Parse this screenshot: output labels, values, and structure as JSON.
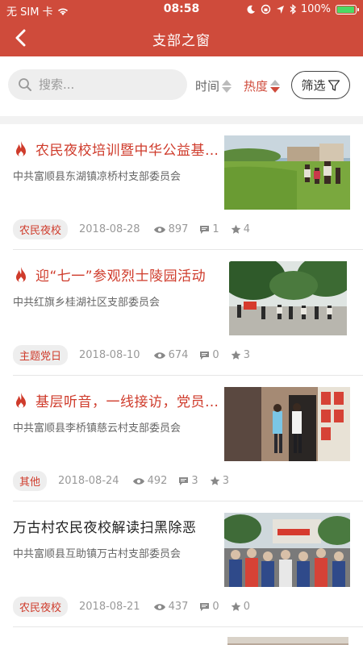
{
  "status_bar": {
    "carrier": "无 SIM 卡",
    "time": "08:58",
    "battery": "100%",
    "battery_level": 1.0
  },
  "nav": {
    "title": "支部之窗",
    "back_icon": "chevron-left-icon"
  },
  "filter": {
    "search_placeholder": "搜索...",
    "sort_time_label": "时间",
    "sort_hot_label": "热度",
    "screen_label": "筛选",
    "accent": "#cf4b3b"
  },
  "items": [
    {
      "hot": true,
      "title": "农民夜校培训暨中华公益基金会",
      "org": "中共富顺县东湖镇凉桥村支部委员会",
      "tag": "农民夜校",
      "date": "2018-08-28",
      "views": "897",
      "comments": "1",
      "stars": "4"
    },
    {
      "hot": true,
      "title": "迎“七一”参观烈士陵园活动",
      "org": "中共红旗乡桂湖社区支部委员会",
      "tag": "主题党日",
      "date": "2018-08-10",
      "views": "674",
      "comments": "0",
      "stars": "3"
    },
    {
      "hot": true,
      "title": "基层听音，一线接访，党员干部",
      "org": "中共富顺县李桥镇慈云村支部委员会",
      "tag": "其他",
      "date": "2018-08-24",
      "views": "492",
      "comments": "3",
      "stars": "3"
    },
    {
      "hot": false,
      "title": "万古村农民夜校解读扫黑除恶",
      "org": "中共富顺县互助镇万古村支部委员会",
      "tag": "农民夜校",
      "date": "2018-08-21",
      "views": "437",
      "comments": "0",
      "stars": "0"
    }
  ]
}
